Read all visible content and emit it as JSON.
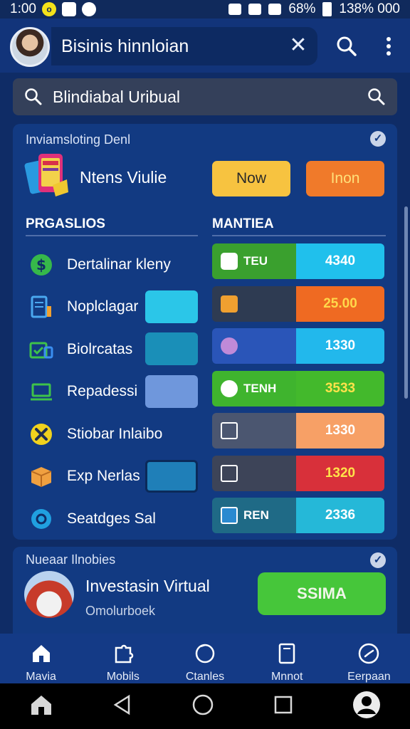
{
  "status_bar": {
    "time": "1:00",
    "battery_text": "68%",
    "right_text": "138% 000"
  },
  "app_bar": {
    "title": "Bisinis hinnloian"
  },
  "search": {
    "value": "Blindiabal Uribual"
  },
  "card": {
    "header": "Inviamsloting Denl",
    "feature_label": "Ntens Viulie",
    "buttons": {
      "now": "Now",
      "inon": "Inon"
    },
    "left_column_header": "PRGASLIOS",
    "right_column_header": "MANTIEA",
    "left_items": [
      {
        "label": "Dertalinar kleny",
        "icon": "dollar-icon",
        "swatch": ""
      },
      {
        "label": "Noplclagar",
        "icon": "document-icon",
        "swatch": "#2bc6e8"
      },
      {
        "label": "Biolrcatas",
        "icon": "folder-icon",
        "swatch": "#1a8fb8"
      },
      {
        "label": "Repadessi",
        "icon": "laptop-icon",
        "swatch": "#6f97dc"
      },
      {
        "label": "Stiobar Inlaibo",
        "icon": "tools-icon",
        "swatch": ""
      },
      {
        "label": "Exp Nerlas",
        "icon": "box-icon",
        "swatch": "#1f7fb8"
      },
      {
        "label": "Seatdges Sal",
        "icon": "gear-icon",
        "swatch": ""
      }
    ],
    "right_items": [
      {
        "label": "TEU",
        "value": "4340",
        "left_color": "#3aa02e",
        "right_color": "#20c0ec",
        "value_color": "#ffffff"
      },
      {
        "label": "",
        "value": "25.00",
        "left_color": "#2e3b52",
        "right_color": "#ef6a22",
        "value_color": "#ffd84a"
      },
      {
        "label": "",
        "value": "1330",
        "left_color": "#2a55b8",
        "right_color": "#22b8ec",
        "value_color": "#ffffff"
      },
      {
        "label": "TENH",
        "value": "3533",
        "left_color": "#3fb42e",
        "right_color": "#43b92c",
        "value_color": "#ffe24a"
      },
      {
        "label": "",
        "value": "1330",
        "left_color": "#4b5670",
        "right_color": "#f7a066",
        "value_color": "#ffffff"
      },
      {
        "label": "",
        "value": "1320",
        "left_color": "#3d4458",
        "right_color": "#d8303a",
        "value_color": "#ffe24a"
      },
      {
        "label": "REN",
        "value": "2336",
        "left_color": "#1f6a86",
        "right_color": "#25b8d8",
        "value_color": "#ffffff"
      }
    ]
  },
  "card2": {
    "header": "Nueaar Ilnobies",
    "title": "Investasin Virtual",
    "subtitle": "Omolurboek",
    "button": "SSIMA"
  },
  "bottom_nav": [
    {
      "label": "Mavia",
      "icon": "home-icon"
    },
    {
      "label": "Mobils",
      "icon": "puzzle-icon"
    },
    {
      "label": "Ctanles",
      "icon": "refresh-icon"
    },
    {
      "label": "Mnnot",
      "icon": "tablet-icon"
    },
    {
      "label": "Eerpaan",
      "icon": "clock-icon"
    }
  ]
}
